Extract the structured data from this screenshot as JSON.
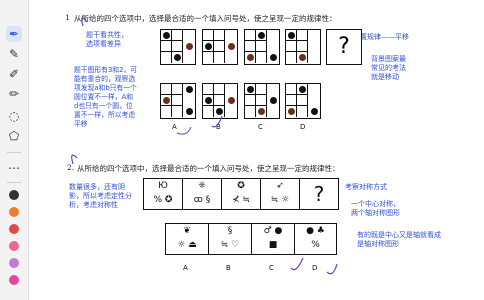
{
  "toolbar": {
    "tools": [
      "pen-nib-icon",
      "pen-icon",
      "highlighter-icon",
      "marker-icon",
      "lasso-icon",
      "shapes-icon",
      "more-icon"
    ],
    "colors": [
      "#333333",
      "#f07c2b",
      "#e04a4a",
      "#e96a8a",
      "#c07ad9",
      "#e3469a"
    ]
  },
  "q1": {
    "number": "1",
    "text": "从所给的四个选项中，选择最合适的一个填入问号处，使之呈现一定的规律性：",
    "question_mark": "?",
    "options": [
      "A",
      "B",
      "C",
      "D"
    ],
    "note_left_1": "题干看共性，\n选项看差异",
    "note_left_2": "题干图形有3和2，可\n能有重合的，观察选\n项发现a和b只有一个\n圆位置不一样，A和\nd也只有一个圆，位\n置不一样，所以考虑\n平移",
    "note_right_1": "考察位置规律——平移",
    "note_right_2": "背景图案最\n常见的考法\n就是移动"
  },
  "q2": {
    "number": "2.",
    "text": "从所给的四个选项中，选择最合适的一个填入问号处，使之呈现一定的规律性：",
    "note_left": "数量很多，还有阴\n影，所以考虑定性分\n析，考虑对称性",
    "note_right_1": "考察对称方式",
    "note_right_2": "一个中心对称，\n两个轴对称图形",
    "note_right_3": "有的既是中心又是轴就看成\n是轴对称图形",
    "stem_symbols": [
      {
        "top": "Ю",
        "bottom": "% ✪"
      },
      {
        "top": "⁜",
        "bottom": "ꝏ  §"
      },
      {
        "top": "✪",
        "bottom": "⊀ ≒"
      },
      {
        "top": "➶",
        "bottom": "≒  ☼"
      }
    ],
    "question_mark": "?",
    "option_symbols": [
      {
        "top": "❦",
        "bottom": "☼ ⏏"
      },
      {
        "top": "§",
        "bottom": "≒ ♡"
      },
      {
        "top": "♂ ●",
        "bottom": "■"
      },
      {
        "top": "● ♣",
        "bottom": "%"
      }
    ],
    "options": [
      "A",
      "B",
      "C",
      "D"
    ]
  }
}
